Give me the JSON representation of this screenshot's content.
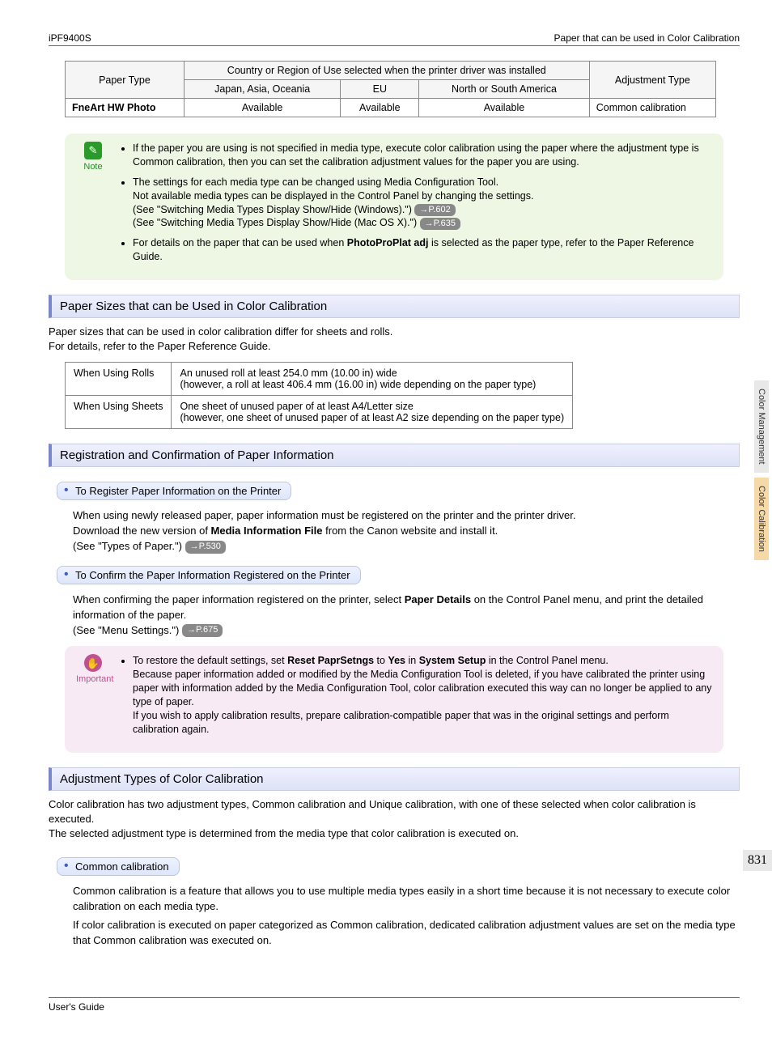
{
  "header": {
    "model": "iPF9400S",
    "topic": "Paper that can be used in Color Calibration"
  },
  "table1": {
    "h_paper": "Paper Type",
    "h_region": "Country or Region of Use selected when the printer driver was installed",
    "h_r1": "Japan, Asia, Oceania",
    "h_r2": "EU",
    "h_r3": "North or South America",
    "h_adj": "Adjustment Type",
    "row": {
      "name": "FneArt HW Photo",
      "c1": "Available",
      "c2": "Available",
      "c3": "Available",
      "adj": "Common calibration"
    }
  },
  "note": {
    "label": "Note",
    "b1": "If the paper you are using is not specified in media type, execute color calibration using the paper where the adjustment type is Common calibration, then you can set the calibration adjustment values for the paper you are using.",
    "b2a": "The settings for each media type can be changed using Media Configuration Tool.",
    "b2b": "Not available media types can be displayed in the Control Panel by changing the settings.",
    "b2c": "(See \"Switching Media Types Display Show/Hide (Windows).\")",
    "ref1": "→P.602",
    "b2d": "(See \"Switching Media Types Display Show/Hide (Mac OS X).\")",
    "ref2": "→P.635",
    "b3a": "For details on the paper that can be used when ",
    "b3bold": "PhotoProPlat adj",
    "b3b": " is selected as the paper type, refer to the Paper Reference Guide."
  },
  "sec1": {
    "title": "Paper Sizes that can be Used in Color Calibration",
    "p1": "Paper sizes that can be used in color calibration differ for sheets and rolls.",
    "p2": "For details, refer to the Paper Reference Guide.",
    "t": {
      "r1a": "When Using Rolls",
      "r1b": "An unused roll at least 254.0 mm (10.00 in) wide\n(however, a roll at least 406.4 mm (16.00 in) wide depending on the paper type)",
      "r2a": "When Using Sheets",
      "r2b": "One sheet of unused paper of at least A4/Letter size\n(however, one sheet of unused paper of at least A2 size depending on the paper type)"
    }
  },
  "sec2": {
    "title": "Registration and Confirmation of Paper Information",
    "sub1": "To Register Paper Information on the Printer",
    "s1a": "When using newly released paper, paper information must be registered on the printer and the printer driver.",
    "s1b_pre": "Download the new version of ",
    "s1b_bold": "Media Information File",
    "s1b_post": " from the Canon website and install it.",
    "s1c": "(See \"Types of Paper.\")",
    "ref1": "→P.530",
    "sub2": "To Confirm the Paper Information Registered on the Printer",
    "s2a_pre": "When confirming the paper information registered on the printer, select ",
    "s2a_bold": "Paper Details",
    "s2a_post": " on the Control Panel menu, and print the detailed information of the paper.",
    "s2b": "(See \"Menu Settings.\")",
    "ref2": "→P.675"
  },
  "important": {
    "label": "Important",
    "l1_pre": "To restore the default settings, set ",
    "l1_b1": "Reset PaprSetngs",
    "l1_mid1": " to ",
    "l1_b2": "Yes",
    "l1_mid2": " in ",
    "l1_b3": "System Setup",
    "l1_post": " in the Control Panel menu.",
    "l2": "Because paper information added or modified by the Media Configuration Tool is deleted, if you have calibrated the printer using paper with information added by the Media Configuration Tool, color calibration executed this way can no longer be applied to any type of paper.",
    "l3": "If you wish to apply calibration results, prepare calibration-compatible paper that was in the original settings and perform calibration again."
  },
  "sec3": {
    "title": "Adjustment Types of Color Calibration",
    "p1": "Color calibration has two adjustment types, Common calibration and Unique calibration, with one of these selected when color calibration is executed.",
    "p2": "The selected adjustment type is determined from the media type that color calibration is executed on.",
    "sub1": "Common calibration",
    "s1": "Common calibration is a feature that allows you to use multiple media types easily in a short time because it is not necessary to execute color calibration on each media type.",
    "s2": "If color calibration is executed on paper categorized as Common calibration, dedicated calibration adjustment values are set on the media type that Common calibration was executed on."
  },
  "side": {
    "tab1": "Color Management",
    "tab2": "Color Calibration"
  },
  "pagenum": "831",
  "footer": "User's Guide"
}
